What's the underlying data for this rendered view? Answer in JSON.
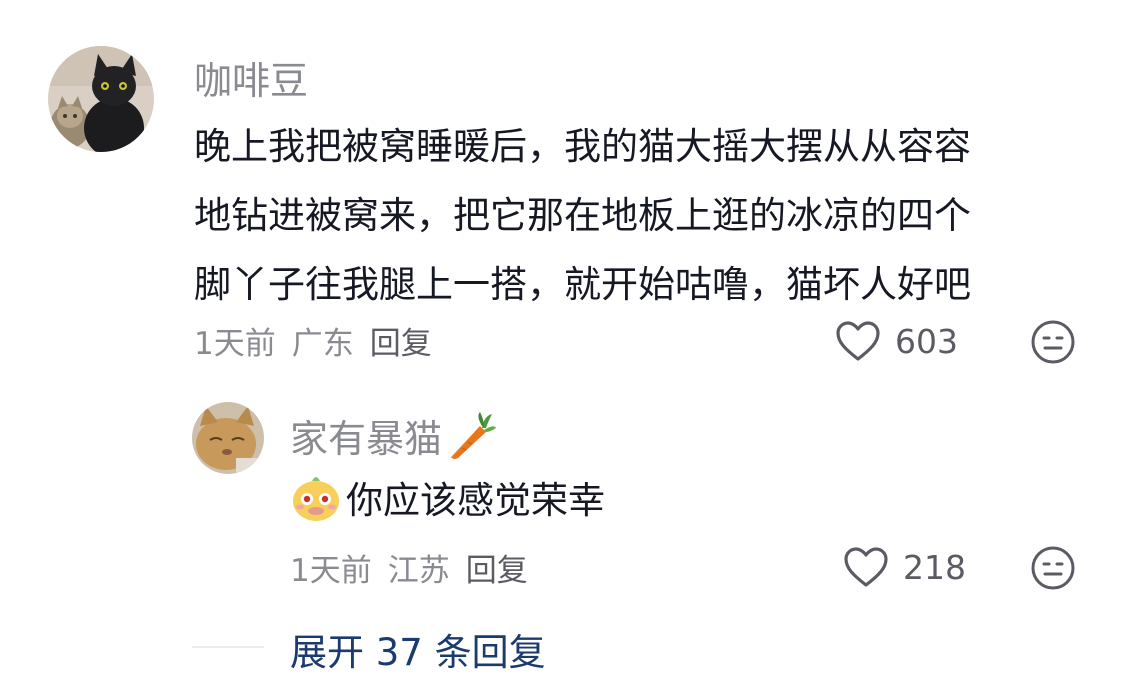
{
  "main_comment": {
    "username": "咖啡豆",
    "text_lines": [
      "晚上我把被窝睡暖后，我的猫大摇大摆从从容容",
      "地钻进被窝来，把它那在地板上逛的冰凉的四个",
      "脚丫子往我腿上一搭，就开始咕噜，猫坏人好吧"
    ],
    "time": "1天前",
    "location": "广东",
    "reply_label": "回复",
    "like_count": "603",
    "like_icon": "heart-outline-icon",
    "dislike_icon": "meh-face-icon"
  },
  "reply_comment": {
    "username": "家有暴猫",
    "username_emoji": "carrot-icon",
    "emoji": "sticker-face-icon",
    "text": "你应该感觉荣幸",
    "time": "1天前",
    "location": "江苏",
    "reply_label": "回复",
    "like_count": "218"
  },
  "expand_replies": "展开 37 条回复",
  "colors": {
    "text_primary": "#161823",
    "text_secondary": "#8a8b91",
    "link": "#1b3b6f"
  }
}
